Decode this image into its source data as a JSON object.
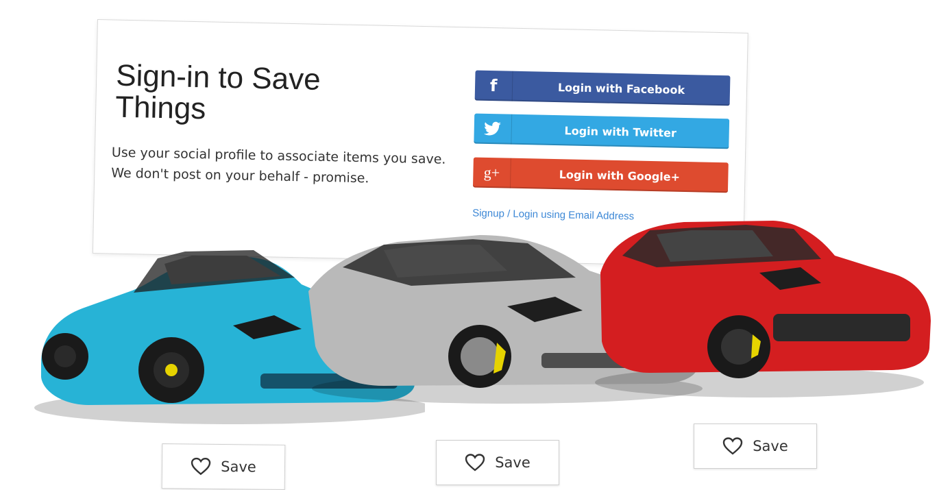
{
  "signin": {
    "title": "Sign-in to Save Things",
    "description": "Use your social profile to associate items you save. We don't post on your behalf - promise.",
    "facebook_label": "Login with Facebook",
    "twitter_label": "Login with Twitter",
    "google_label": "Login with Google+",
    "facebook_icon": "f",
    "google_icon": "g+",
    "email_link": "Signup / Login using Email Address"
  },
  "cars": [
    {
      "color": "#27b3d6",
      "icon": "convertible-car",
      "save_label": "Save"
    },
    {
      "color": "#b9b9b9",
      "icon": "sedan-car",
      "save_label": "Save"
    },
    {
      "color": "#d41e20",
      "icon": "suv-car",
      "save_label": "Save"
    }
  ],
  "colors": {
    "facebook": "#3b5aa0",
    "twitter": "#33a8e3",
    "google": "#de4b2f",
    "link": "#3d88d6"
  }
}
